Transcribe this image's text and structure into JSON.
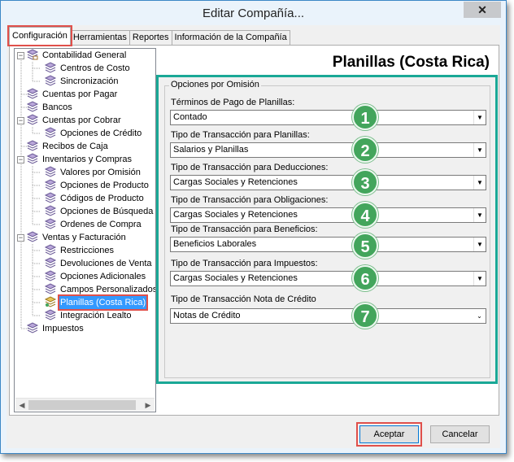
{
  "window": {
    "title": "Editar Compañía..."
  },
  "tabs": [
    {
      "label": "Configuración"
    },
    {
      "label": "Herramientas"
    },
    {
      "label": "Reportes"
    },
    {
      "label": "Información de la Compañía"
    }
  ],
  "tree": {
    "items": [
      {
        "label": "Contabilidad General"
      },
      {
        "label": "Centros de Costo"
      },
      {
        "label": "Sincronización"
      },
      {
        "label": "Cuentas por Pagar"
      },
      {
        "label": "Bancos"
      },
      {
        "label": "Cuentas por Cobrar"
      },
      {
        "label": "Opciones de Crédito"
      },
      {
        "label": "Recibos de Caja"
      },
      {
        "label": "Inventarios y Compras"
      },
      {
        "label": "Valores por Omisión"
      },
      {
        "label": "Opciones de Producto"
      },
      {
        "label": "Códigos de Producto"
      },
      {
        "label": "Opciones de Búsqueda"
      },
      {
        "label": "Ordenes de Compra"
      },
      {
        "label": "Ventas y Facturación"
      },
      {
        "label": "Restricciones"
      },
      {
        "label": "Devoluciones de Venta"
      },
      {
        "label": "Opciones Adicionales"
      },
      {
        "label": "Campos Personalizados"
      },
      {
        "label": "Planillas (Costa Rica)"
      },
      {
        "label": "Integración Lealto"
      },
      {
        "label": "Impuestos"
      }
    ]
  },
  "header": {
    "title": "Planillas (Costa Rica)"
  },
  "options": {
    "group_label": "Opciones por Omisión",
    "fields": [
      {
        "label": "Términos de Pago de Planillas:",
        "value": "Contado",
        "badge": "1"
      },
      {
        "label": "Tipo de Transacción para Planillas:",
        "value": "Salarios y Planillas",
        "badge": "2"
      },
      {
        "label": "Tipo de Transacción para Deducciones:",
        "value": "Cargas Sociales y Retenciones",
        "badge": "3"
      },
      {
        "label": "Tipo de Transacción para Obligaciones:",
        "value": "Cargas Sociales y Retenciones",
        "badge": "4"
      },
      {
        "label": "Tipo de Transacción para Beneficios:",
        "value": "Beneficios Laborales",
        "badge": "5"
      },
      {
        "label": "Tipo de Transacción para Impuestos:",
        "value": "Cargas Sociales y Retenciones",
        "badge": "6"
      },
      {
        "label": "Tipo de Transacción Nota de Crédito",
        "value": "Notas de Crédito",
        "badge": "7"
      }
    ]
  },
  "buttons": {
    "accept": "Aceptar",
    "cancel": "Cancelar"
  },
  "colors": {
    "highlight_red": "#e0504b",
    "frame_teal": "#1aa896",
    "badge_green": "#43a55c",
    "selection_blue": "#3399ff"
  }
}
